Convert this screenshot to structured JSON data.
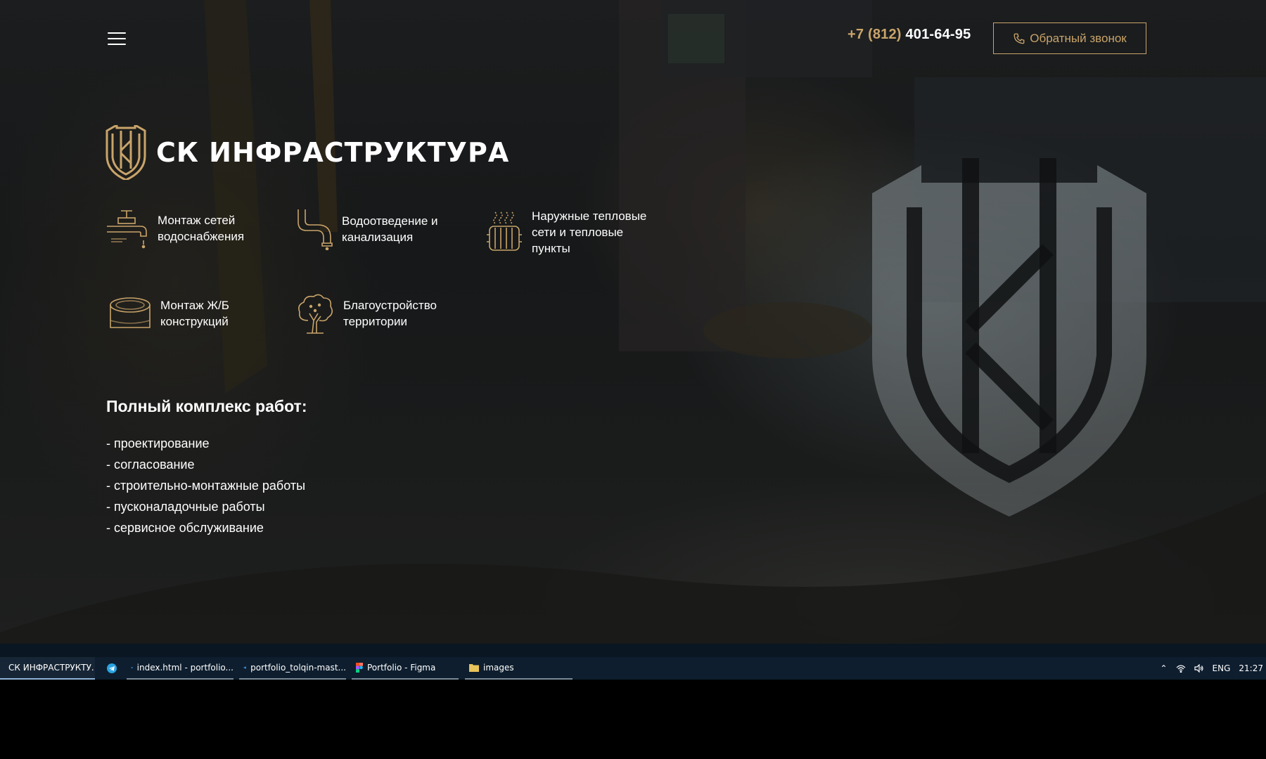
{
  "colors": {
    "accent": "#c9a46a",
    "taskbar": "#0e1e2e"
  },
  "header": {
    "menu_icon": "hamburger-icon",
    "phone_code": "+7 (812)",
    "phone_number": "401-64-95",
    "callback_label": "Обратный звонок",
    "callback_icon": "phone-icon"
  },
  "logo": {
    "mark": "ski-shield-logo",
    "text": "СК ИНФРАСТРУКТУРА"
  },
  "services": [
    {
      "icon": "water-tap-icon",
      "line1": "Монтаж сетей",
      "line2": "водоснабжения",
      "line3": ""
    },
    {
      "icon": "drain-pipe-icon",
      "line1": "Водоотведение и",
      "line2": "канализация",
      "line3": ""
    },
    {
      "icon": "radiator-icon",
      "line1": "Наружные тепловые",
      "line2": "сети и тепловые",
      "line3": "пункты"
    },
    {
      "icon": "concrete-ring-icon",
      "line1": "Монтаж Ж/Б",
      "line2": "конструкций",
      "line3": ""
    },
    {
      "icon": "tree-icon",
      "line1": "Благоустройство",
      "line2": "территории",
      "line3": ""
    }
  ],
  "complex": {
    "title": "Полный комплекс работ:",
    "items": [
      "- проектирование",
      "- согласование",
      "- строительно-монтажные работы",
      "- пусконаладочные работы",
      "- сервисное обслуживание"
    ]
  },
  "taskbar": {
    "tasks": [
      {
        "icon": "browser-icon",
        "label": "СК ИНФРАСТРУКТУ..."
      },
      {
        "icon": "telegram-icon",
        "label": ""
      },
      {
        "icon": "vscode-icon",
        "label": "index.html - portfolio..."
      },
      {
        "icon": "vscode-icon",
        "label": "portfolio_tolqin-mast..."
      },
      {
        "icon": "figma-icon",
        "label": "Portfolio - Figma"
      },
      {
        "icon": "folder-icon",
        "label": "images"
      }
    ],
    "tray": {
      "lang": "ENG",
      "time": "21:27"
    }
  }
}
